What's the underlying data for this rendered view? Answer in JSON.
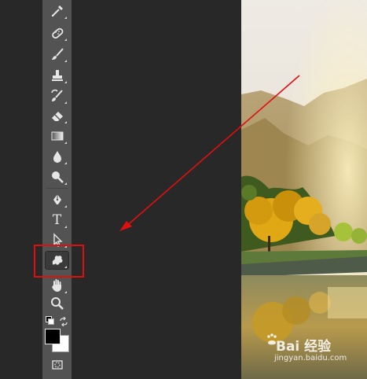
{
  "toolbar": {
    "tools": [
      {
        "name": "eyedropper-icon"
      },
      {
        "name": "spot-healing-brush-icon"
      },
      {
        "name": "brush-icon"
      },
      {
        "name": "clone-stamp-icon"
      },
      {
        "name": "history-brush-icon"
      },
      {
        "name": "eraser-icon"
      },
      {
        "name": "gradient-icon"
      },
      {
        "name": "blur-icon"
      },
      {
        "name": "dodge-icon"
      },
      {
        "name": "pen-icon"
      },
      {
        "name": "type-icon",
        "label": "T"
      },
      {
        "name": "path-selection-icon"
      },
      {
        "name": "custom-shape-icon",
        "selected": true
      },
      {
        "name": "hand-icon"
      },
      {
        "name": "zoom-icon"
      }
    ],
    "foreground_color": "#000000",
    "background_color": "#ffffff"
  },
  "annotation": {
    "highlight_color": "#e00f0f",
    "arrow_color": "#e00f0f"
  },
  "watermark": {
    "main": "Bai 经验",
    "sub": "jingyan.baidu.com"
  }
}
